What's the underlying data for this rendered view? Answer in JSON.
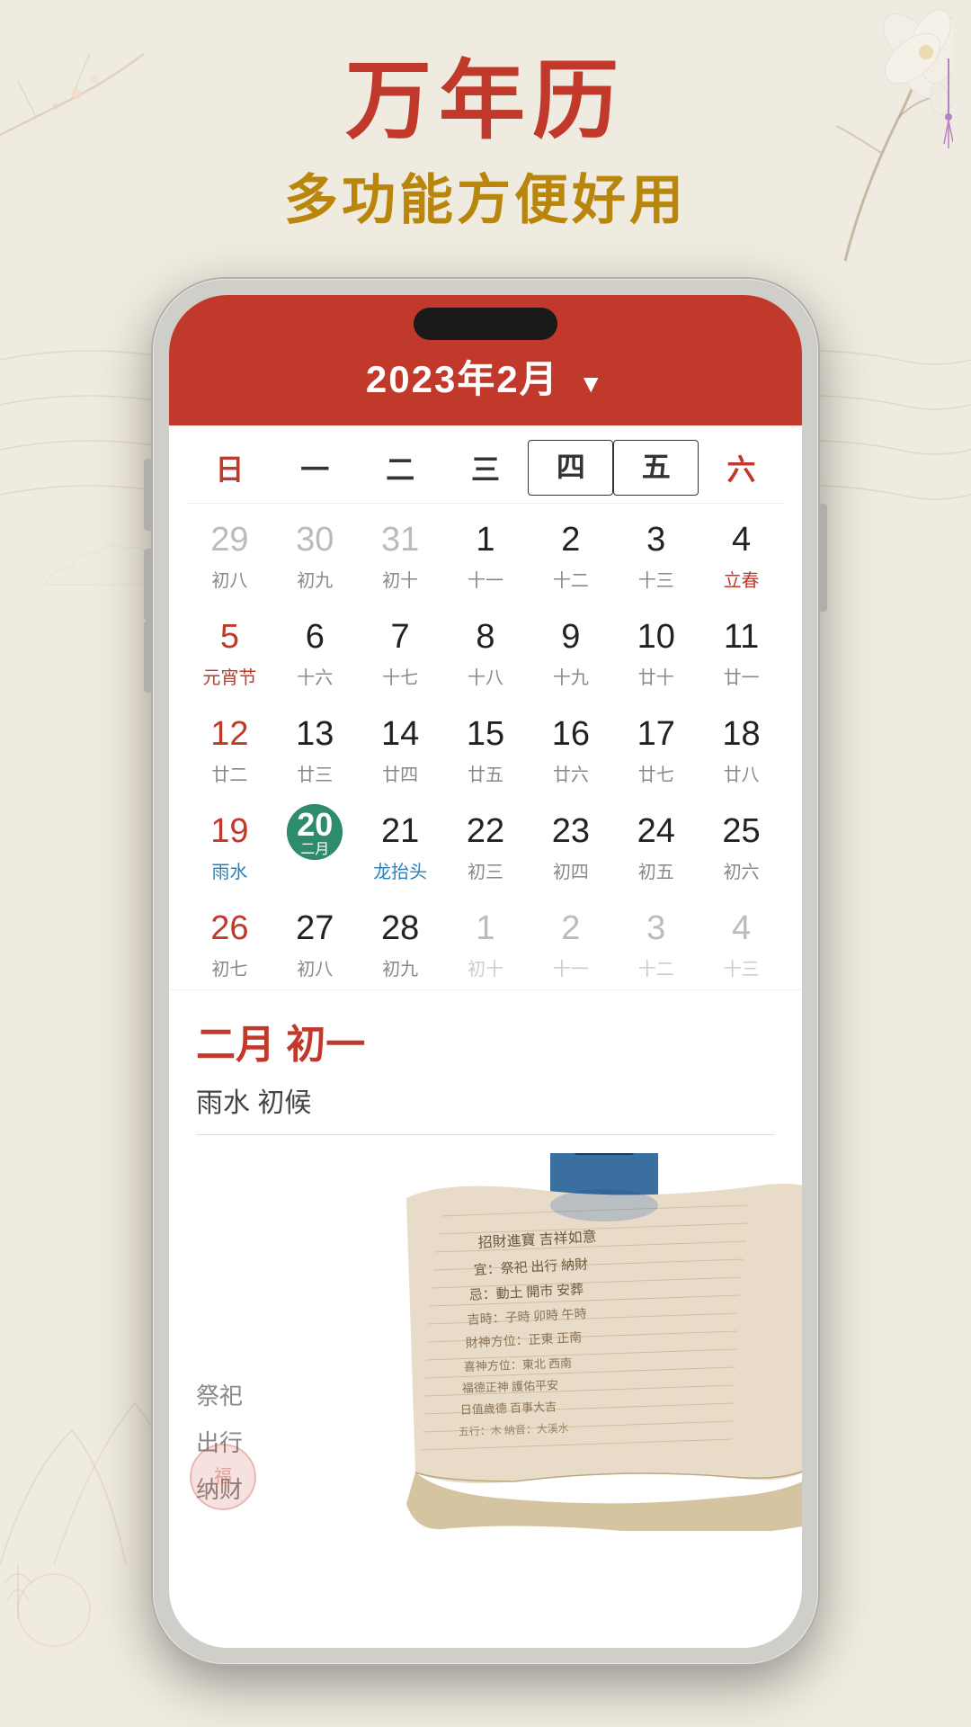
{
  "app": {
    "title": "万年历",
    "subtitle": "多功能方便好用"
  },
  "calendar": {
    "header": "2023年2月",
    "weekdays": [
      "日",
      "一",
      "二",
      "三",
      "四",
      "五",
      "六"
    ],
    "weekday_bordered": [
      "四",
      "五"
    ],
    "month": "2月",
    "selected_day": "20",
    "selected_lunar": "二月",
    "detail": {
      "date_label": "二月 初一",
      "info": "雨水 初候"
    },
    "rows": [
      [
        {
          "day": "29",
          "lunar": "初八",
          "type": "prev-gray"
        },
        {
          "day": "30",
          "lunar": "初九",
          "type": "prev-gray"
        },
        {
          "day": "31",
          "lunar": "初十",
          "type": "prev-gray"
        },
        {
          "day": "1",
          "lunar": "十一",
          "type": "normal"
        },
        {
          "day": "2",
          "lunar": "十二",
          "type": "normal"
        },
        {
          "day": "3",
          "lunar": "十三",
          "type": "normal"
        },
        {
          "day": "4",
          "lunar": "立春",
          "type": "normal-sat",
          "lunar_special": true
        }
      ],
      [
        {
          "day": "5",
          "lunar": "元宵节",
          "type": "sun",
          "lunar_red": true
        },
        {
          "day": "6",
          "lunar": "十六",
          "type": "normal"
        },
        {
          "day": "7",
          "lunar": "十七",
          "type": "normal"
        },
        {
          "day": "8",
          "lunar": "十八",
          "type": "normal"
        },
        {
          "day": "9",
          "lunar": "十九",
          "type": "normal"
        },
        {
          "day": "10",
          "lunar": "廿十",
          "type": "normal"
        },
        {
          "day": "11",
          "lunar": "廿一",
          "type": "normal-sat"
        }
      ],
      [
        {
          "day": "12",
          "lunar": "廿二",
          "type": "sun"
        },
        {
          "day": "13",
          "lunar": "廿三",
          "type": "normal"
        },
        {
          "day": "14",
          "lunar": "廿四",
          "type": "normal"
        },
        {
          "day": "15",
          "lunar": "廿五",
          "type": "normal"
        },
        {
          "day": "16",
          "lunar": "廿六",
          "type": "normal"
        },
        {
          "day": "17",
          "lunar": "廿七",
          "type": "normal"
        },
        {
          "day": "18",
          "lunar": "廿八",
          "type": "normal-sat"
        }
      ],
      [
        {
          "day": "19",
          "lunar": "雨水",
          "type": "sun",
          "lunar_special": true
        },
        {
          "day": "20",
          "lunar": "二月",
          "type": "selected"
        },
        {
          "day": "21",
          "lunar": "龙抬头",
          "type": "normal",
          "lunar_special": true
        },
        {
          "day": "22",
          "lunar": "初三",
          "type": "normal"
        },
        {
          "day": "23",
          "lunar": "初四",
          "type": "normal"
        },
        {
          "day": "24",
          "lunar": "初五",
          "type": "normal"
        },
        {
          "day": "25",
          "lunar": "初六",
          "type": "normal-sat"
        }
      ],
      [
        {
          "day": "26",
          "lunar": "初七",
          "type": "sun"
        },
        {
          "day": "27",
          "lunar": "初八",
          "type": "normal"
        },
        {
          "day": "28",
          "lunar": "初九",
          "type": "normal"
        },
        {
          "day": "1",
          "lunar": "初十",
          "type": "next-gray"
        },
        {
          "day": "2",
          "lunar": "十一",
          "type": "next-gray"
        },
        {
          "day": "3",
          "lunar": "十二",
          "type": "next-gray"
        },
        {
          "day": "4",
          "lunar": "十三",
          "type": "next-gray"
        }
      ]
    ]
  }
}
